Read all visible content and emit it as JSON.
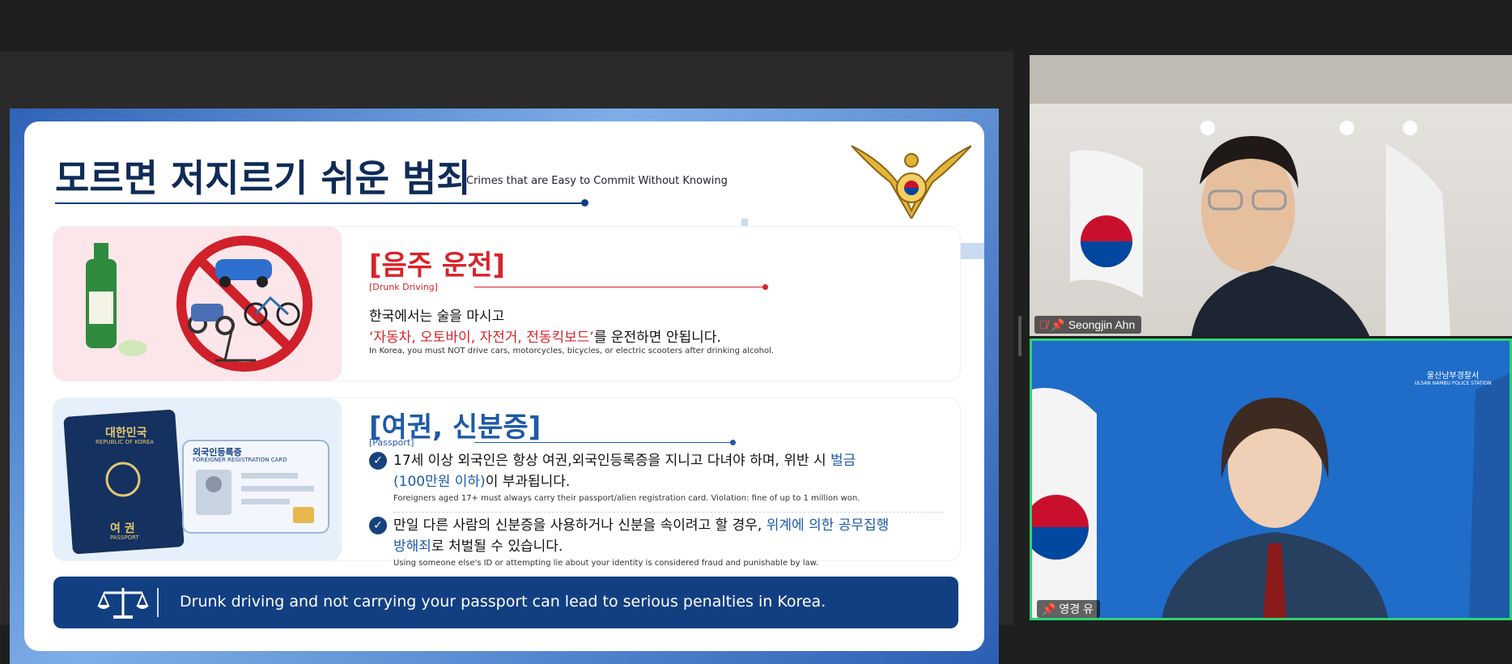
{
  "slide": {
    "title": "모르면 저지르기 쉬운 범죄",
    "subtitle": "Crimes that are Easy to Commit Without Knowing",
    "section1": {
      "title": "[음주 운전]",
      "label": "[Drunk Driving]",
      "line1": "한국에서는 술을 마시고",
      "line2_highlight": "‘자동차, 오토바이, 자전거, 전동킥보드’",
      "line2_rest": "를 운전하면 안됩니다.",
      "english": "In Korea, you must NOT drive cars, motorcycles, bicycles, or electric scooters after drinking alcohol."
    },
    "section2": {
      "title": "[여권, 신분증]",
      "label": "[Passport]",
      "passport_top": "대한민국",
      "passport_top_en": "REPUBLIC OF KOREA",
      "passport_bottom": "여 권",
      "passport_bottom_en": "PASSPORT",
      "card_title": "외국인등록증",
      "card_title_en": "FOREIGNER REGISTRATION CARD",
      "bullet1_a": "17세 이상 외국인은 항상 여권,외국인등록증을 지니고 다녀야 하며, 위반 시 ",
      "bullet1_highlight1": "벌금",
      "bullet1_highlight2": "(100만원 이하)",
      "bullet1_b": "이 부과됩니다.",
      "bullet1_en": "Foreigners aged 17+ must always carry their passport/alien registration card. Violation: fine of up to 1 million won.",
      "bullet2_a": "만일 다른 사람의 신분증을 사용하거나 신분을 속이려고 할 경우, ",
      "bullet2_highlight1": "위계에 의한 공무집행",
      "bullet2_highlight2": "방해죄",
      "bullet2_b": "로 처벌될 수 있습니다.",
      "bullet2_en": "Using someone else's ID or attempting lie about your identity is considered fraud and punishable by law."
    },
    "banner": "Drunk driving and not carrying your passport can lead to serious penalties in Korea."
  },
  "participants": [
    {
      "name": "Seongjin Ahn",
      "muted": true,
      "pinned": true
    },
    {
      "name": "영경 유",
      "muted": false,
      "pinned": true,
      "active_speaker": true
    }
  ],
  "video2_badge": "울산남부경찰서",
  "video2_badge_en": "ULSAN NAMBU POLICE STATION",
  "colors": {
    "accent_red": "#d8232a",
    "accent_blue": "#1e5aa8",
    "navy": "#123f82",
    "speaker_border": "#2ed573"
  }
}
